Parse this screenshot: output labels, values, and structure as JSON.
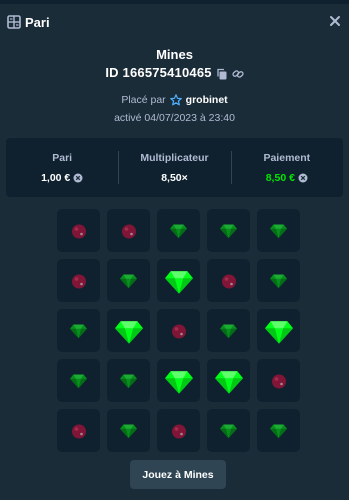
{
  "header": {
    "title": "Pari",
    "icon": "receipt-icon",
    "close_icon": "close-icon"
  },
  "bet": {
    "game": "Mines",
    "id_text": "ID 166575410465",
    "copy_icon": "copy-icon",
    "link_icon": "link-icon",
    "placed_by_label": "Placé par",
    "user_icon": "vip-star-icon",
    "username": "grobinet",
    "date_text": "activé 04/07/2023 à 23:40"
  },
  "stats": {
    "bet_label": "Pari",
    "bet_value": "1,00 €",
    "multiplier_label": "Multiplicateur",
    "multiplier_value": "8,50×",
    "payout_label": "Paiement",
    "payout_value": "8,50 €",
    "currency_icon": "euro-coin-icon"
  },
  "colors": {
    "payout": "#00e701",
    "gem": "#00e701",
    "mine": "#c8183a"
  },
  "grid": {
    "rows": 5,
    "cols": 5,
    "tiles": [
      "mine",
      "mine",
      "gem",
      "gem",
      "gem",
      "mine",
      "gem",
      "gem-revealed",
      "mine",
      "gem",
      "gem",
      "gem-revealed",
      "mine",
      "gem",
      "gem-revealed",
      "gem",
      "gem",
      "gem-revealed",
      "gem-revealed",
      "mine",
      "mine",
      "gem",
      "mine",
      "gem",
      "gem"
    ]
  },
  "button": {
    "label": "Jouez à Mines"
  }
}
